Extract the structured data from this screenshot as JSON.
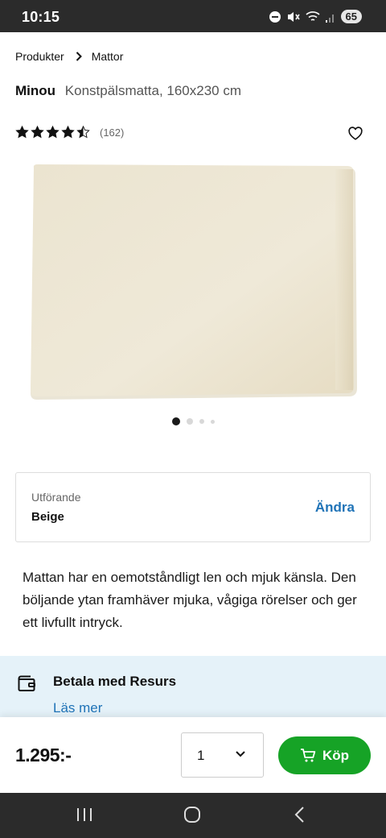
{
  "status_bar": {
    "time": "10:15",
    "battery": "65"
  },
  "breadcrumb": {
    "items": [
      "Produkter",
      "Mattor"
    ]
  },
  "product": {
    "brand": "Minou",
    "description_short": "Konstpälsmatta, 160x230 cm",
    "rating": 4.5,
    "review_count": "(162)",
    "image_color": "#ece5d1"
  },
  "gallery": {
    "count": 4,
    "active": 0
  },
  "variant": {
    "label": "Utförande",
    "value": "Beige",
    "change_label": "Ändra"
  },
  "description": "Mattan har en oemotståndligt len och mjuk känsla. Den böljande ytan framhäver mjuka, vågiga rörelser och ger ett livfullt intryck.",
  "payment": {
    "heading": "Betala med Resurs",
    "link": "Läs mer"
  },
  "buy_bar": {
    "price": "1.295:-",
    "quantity": "1",
    "buy_label": "Köp"
  },
  "colors": {
    "accent_blue": "#1f73b7",
    "buy_green": "#16a326",
    "payment_bg": "#e5f2f9"
  }
}
